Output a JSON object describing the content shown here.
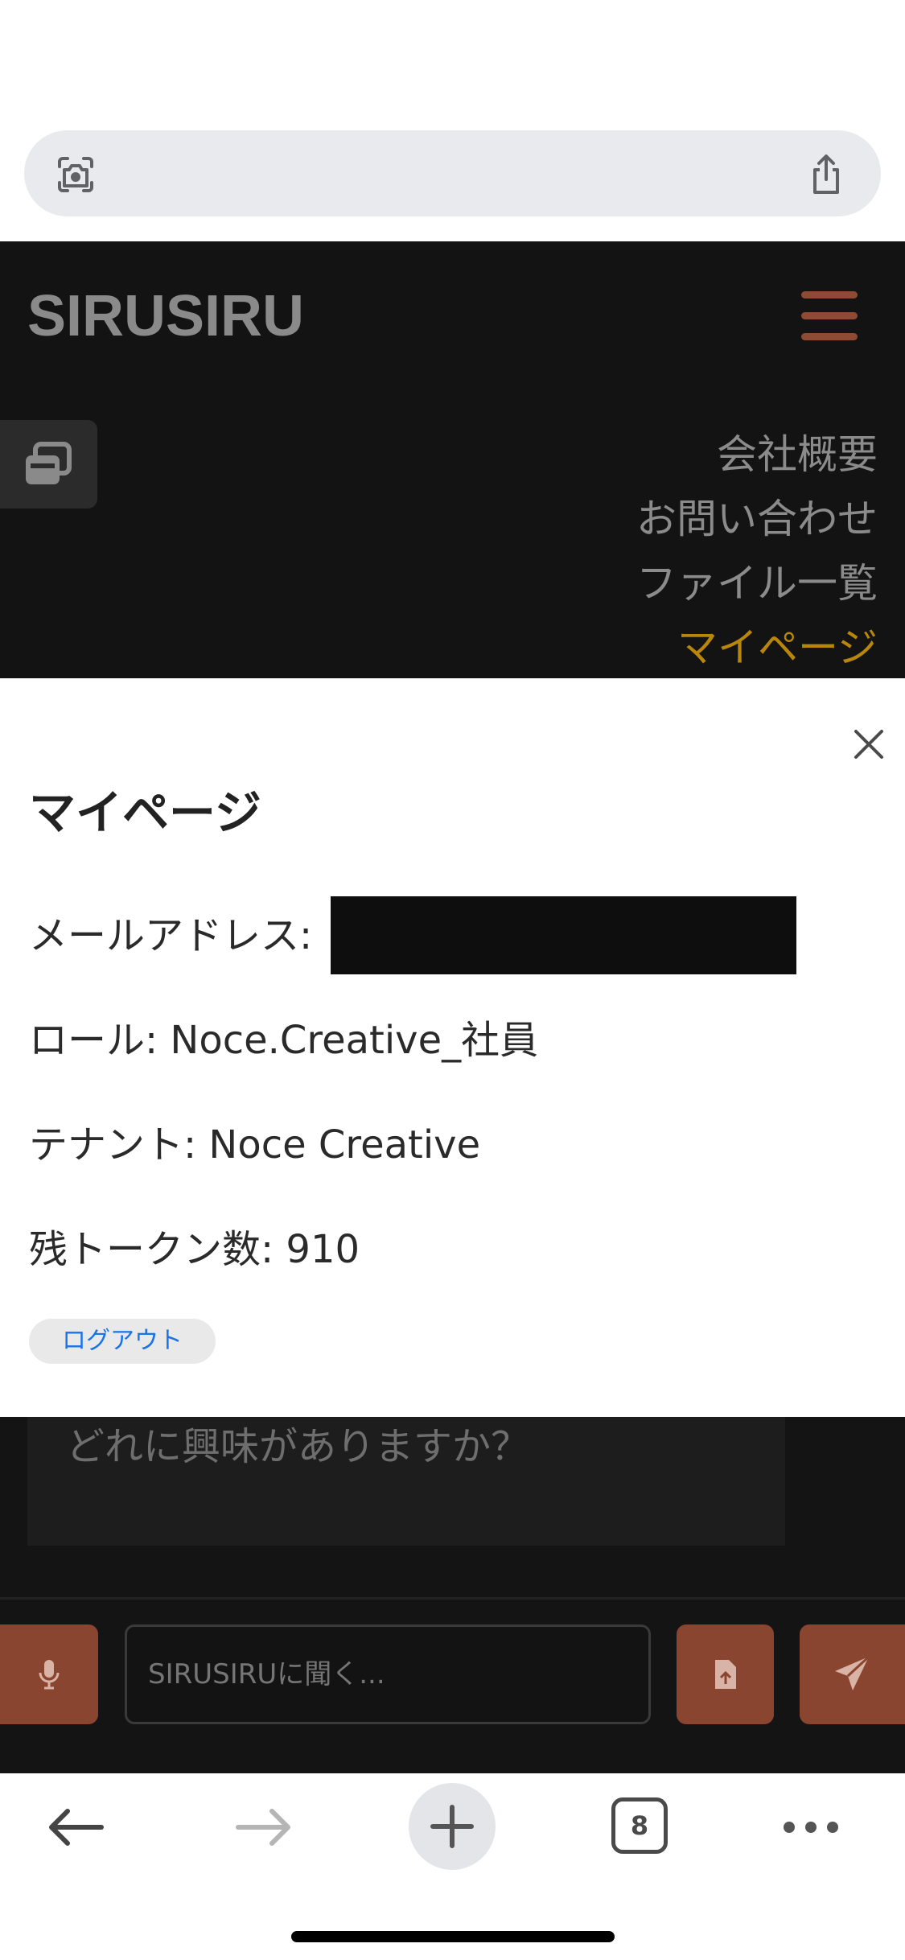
{
  "browser": {
    "tab_count": "8"
  },
  "header": {
    "logo": "SIRUSIRU"
  },
  "nav": {
    "items": [
      {
        "label": "会社概要"
      },
      {
        "label": "お問い合わせ"
      },
      {
        "label": "ファイル一覧"
      },
      {
        "label": "マイページ"
      }
    ]
  },
  "modal": {
    "title": "マイページ",
    "email_label": "メールアドレス:",
    "role": "ロール: Noce.Creative_社員",
    "tenant": "テナント: Noce Creative",
    "tokens": "残トークン数: 910",
    "logout_label": "ログアウト"
  },
  "chat": {
    "suggestion": "どれに興味がありますか？",
    "input_placeholder": "SIRUSIRUに聞く..."
  },
  "colors": {
    "accent": "#8a4530",
    "active_nav": "#b8860b",
    "background_dark": "#131313"
  }
}
